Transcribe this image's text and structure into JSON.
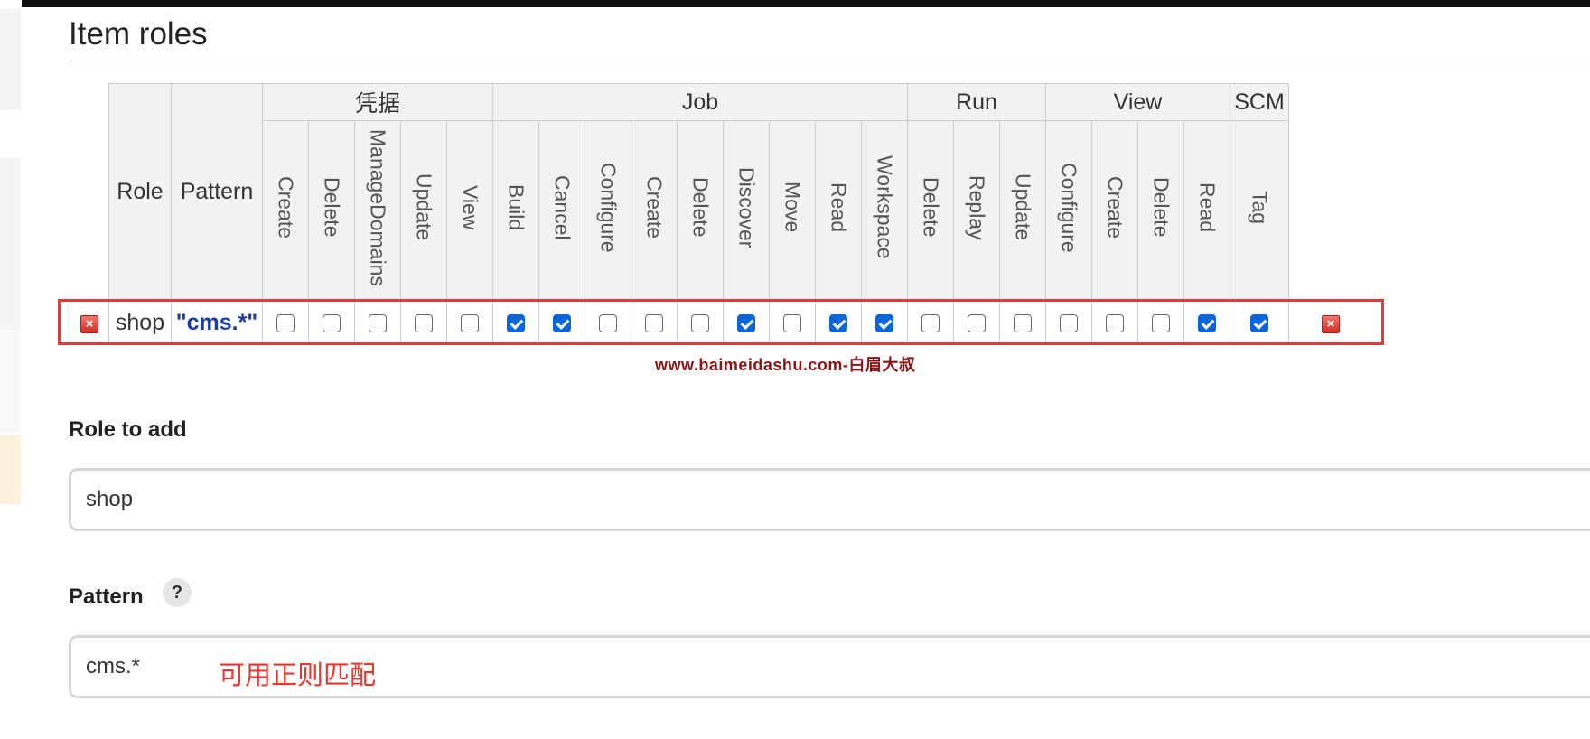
{
  "section": {
    "title": "Item roles"
  },
  "table": {
    "headers": {
      "role": "Role",
      "pattern": "Pattern"
    },
    "groups": [
      {
        "label": "凭据",
        "perms": [
          "Create",
          "Delete",
          "ManageDomains",
          "Update",
          "View"
        ]
      },
      {
        "label": "Job",
        "perms": [
          "Build",
          "Cancel",
          "Configure",
          "Create",
          "Delete",
          "Discover",
          "Move",
          "Read",
          "Workspace"
        ]
      },
      {
        "label": "Run",
        "perms": [
          "Delete",
          "Replay",
          "Update"
        ]
      },
      {
        "label": "View",
        "perms": [
          "Configure",
          "Create",
          "Delete",
          "Read"
        ]
      },
      {
        "label": "SCM",
        "perms": [
          "Tag"
        ]
      }
    ],
    "row": {
      "role": "shop",
      "pattern": "\"cms.*\"",
      "checks": [
        false,
        false,
        false,
        false,
        false,
        true,
        true,
        false,
        false,
        false,
        true,
        false,
        true,
        true,
        false,
        false,
        false,
        false,
        false,
        false,
        true,
        true
      ]
    }
  },
  "watermark": "www.baimeidashu.com-白眉大叔",
  "role_to_add": {
    "label": "Role to add",
    "value": "shop"
  },
  "pattern_field": {
    "label": "Pattern",
    "help": "?",
    "value": "cms.*"
  },
  "annotation": "可用正则匹配",
  "colors": {
    "checked": "#0a66d8",
    "highlight": "#e23a3a",
    "watermark": "#8a1414",
    "annotation": "#e8362f"
  }
}
